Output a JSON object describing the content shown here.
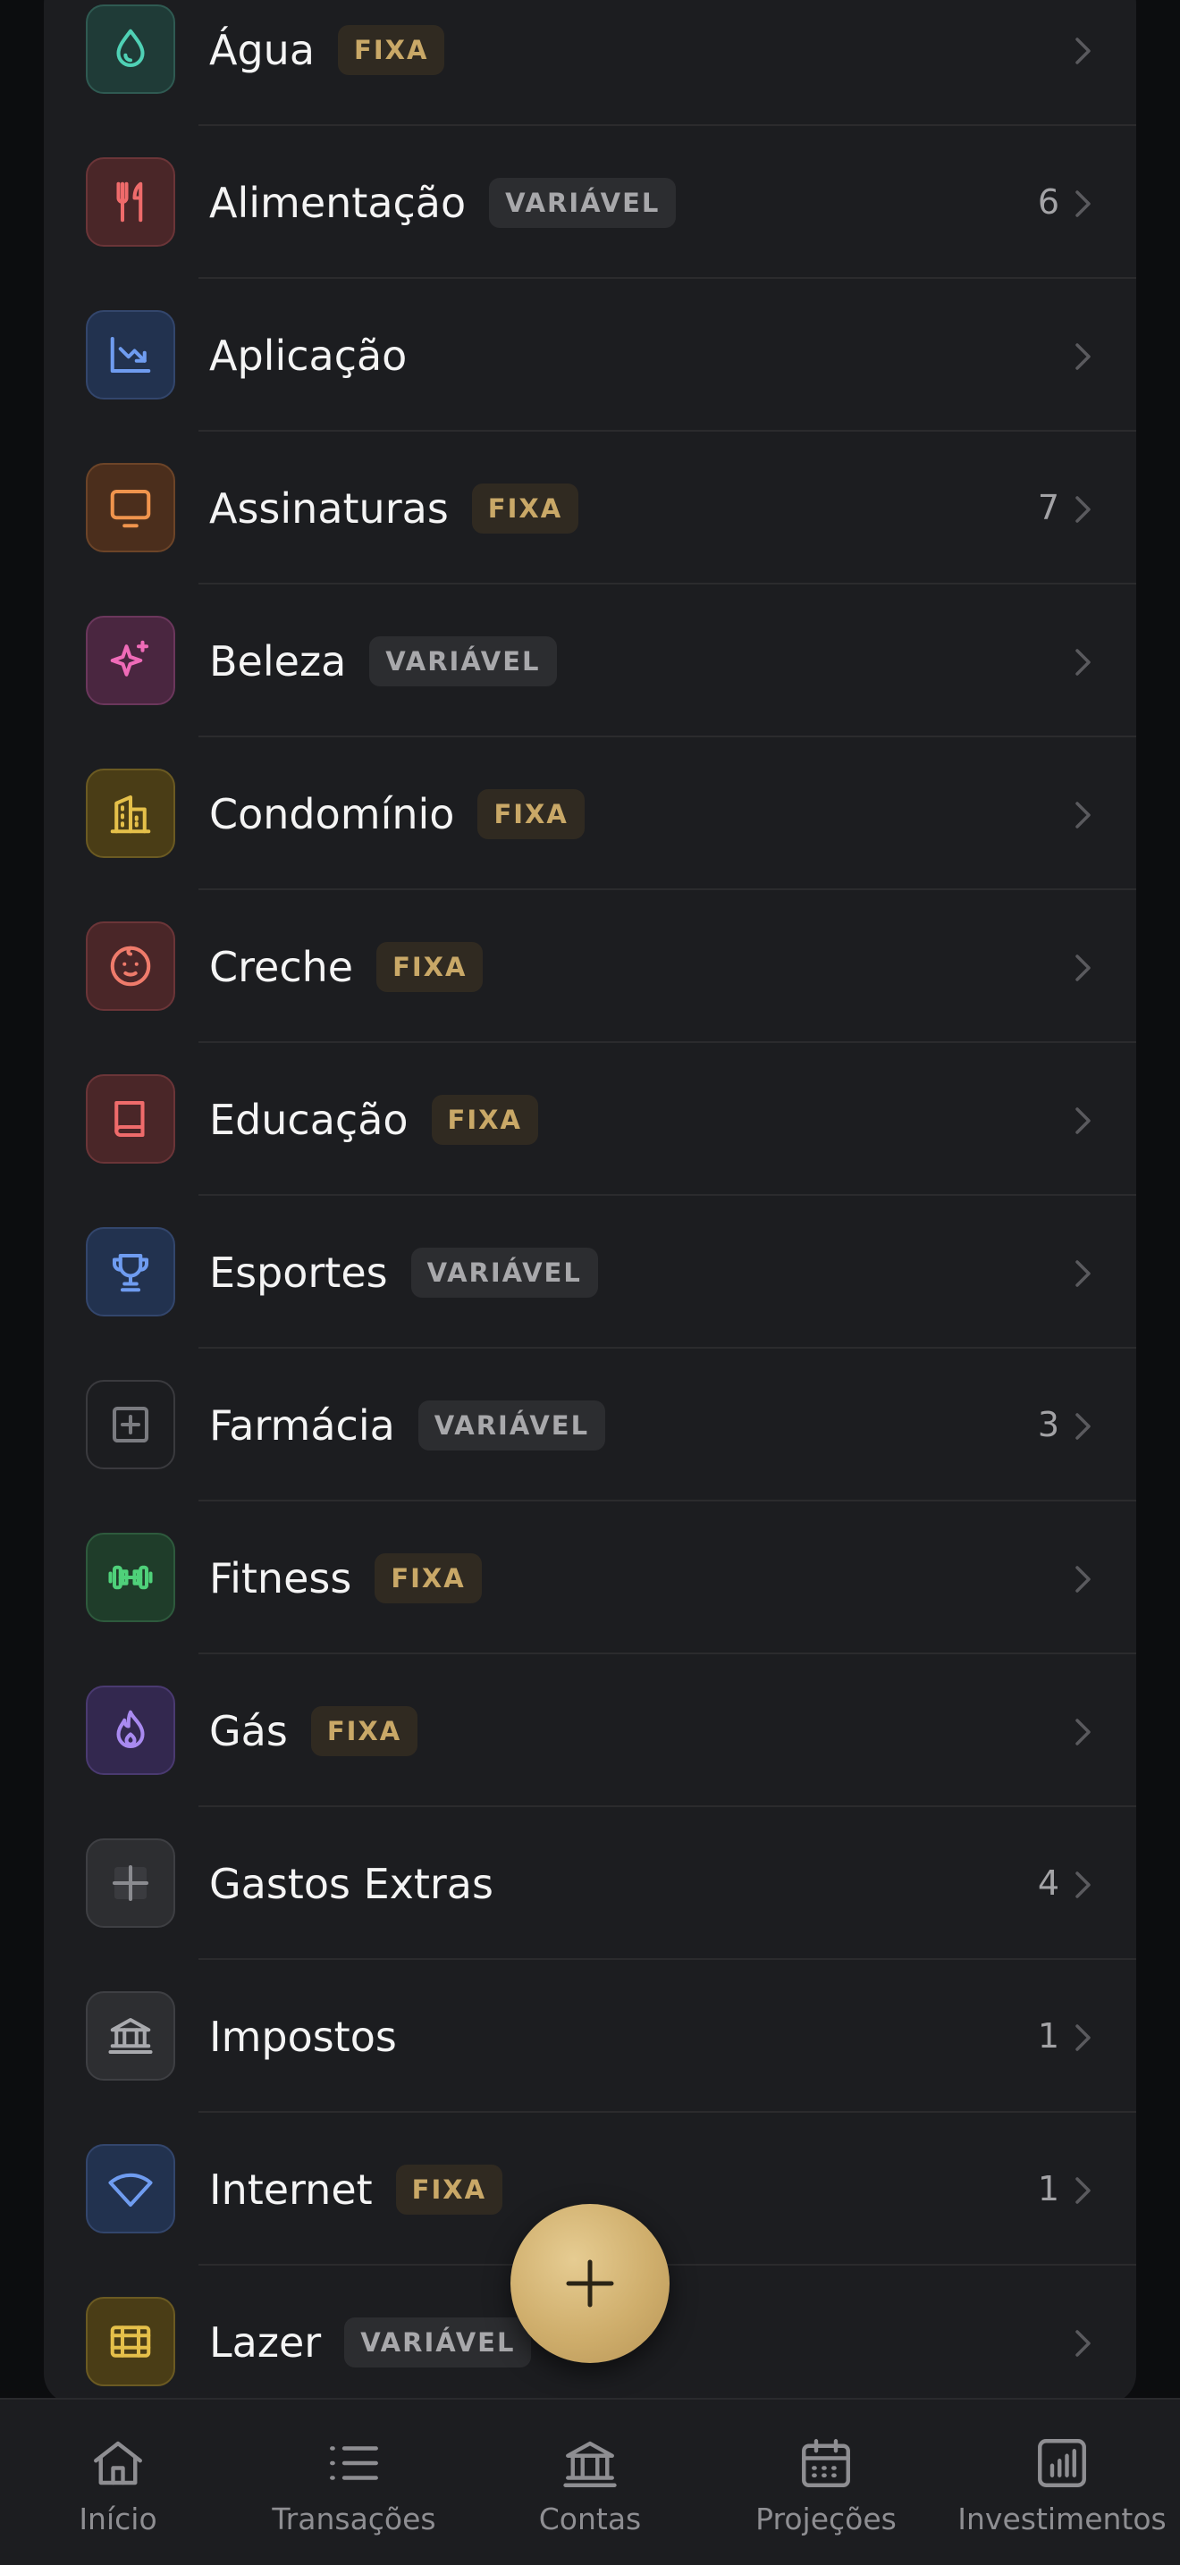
{
  "categories": [
    {
      "name": "Água",
      "badge": "FIXA",
      "count": "",
      "icon": "water-drop-icon"
    },
    {
      "name": "Alimentação",
      "badge": "VARIÁVEL",
      "count": "6",
      "icon": "fork-knife-icon"
    },
    {
      "name": "Aplicação",
      "badge": "",
      "count": "",
      "icon": "chart-down-icon"
    },
    {
      "name": "Assinaturas",
      "badge": "FIXA",
      "count": "7",
      "icon": "tv-icon"
    },
    {
      "name": "Beleza",
      "badge": "VARIÁVEL",
      "count": "",
      "icon": "sparkle-icon"
    },
    {
      "name": "Condomínio",
      "badge": "FIXA",
      "count": "",
      "icon": "building-icon"
    },
    {
      "name": "Creche",
      "badge": "FIXA",
      "count": "",
      "icon": "baby-icon"
    },
    {
      "name": "Educação",
      "badge": "FIXA",
      "count": "",
      "icon": "book-icon"
    },
    {
      "name": "Esportes",
      "badge": "VARIÁVEL",
      "count": "",
      "icon": "trophy-icon"
    },
    {
      "name": "Farmácia",
      "badge": "VARIÁVEL",
      "count": "3",
      "icon": "plus-square-icon"
    },
    {
      "name": "Fitness",
      "badge": "FIXA",
      "count": "",
      "icon": "dumbbell-icon"
    },
    {
      "name": "Gás",
      "badge": "FIXA",
      "count": "",
      "icon": "flame-icon"
    },
    {
      "name": "Gastos Extras",
      "badge": "",
      "count": "4",
      "icon": "plus-icon"
    },
    {
      "name": "Impostos",
      "badge": "",
      "count": "1",
      "icon": "bank-icon"
    },
    {
      "name": "Internet",
      "badge": "FIXA",
      "count": "1",
      "icon": "wifi-icon"
    },
    {
      "name": "Lazer",
      "badge": "VARIÁVEL",
      "count": "",
      "icon": "film-icon"
    }
  ],
  "tabs": [
    {
      "label": "Início",
      "icon": "home-icon"
    },
    {
      "label": "Transações",
      "icon": "list-icon"
    },
    {
      "label": "Contas",
      "icon": "bank-icon"
    },
    {
      "label": "Projeções",
      "icon": "calendar-icon"
    },
    {
      "label": "Investimentos",
      "icon": "bar-chart-icon"
    }
  ],
  "fab": {
    "icon": "plus-icon"
  }
}
